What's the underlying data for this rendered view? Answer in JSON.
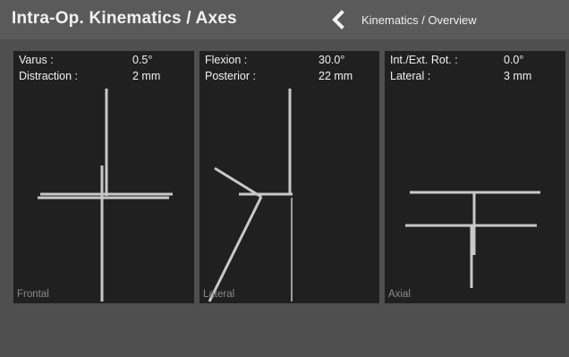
{
  "header": {
    "title": "Intra-Op. Kinematics / Axes",
    "back_label": "Kinematics / Overview",
    "back_icon": "chevron-left-icon"
  },
  "panels": {
    "frontal": {
      "rows": [
        {
          "label": "Varus :",
          "value": "0.5°"
        },
        {
          "label": "Distraction :",
          "value": "2 mm"
        }
      ],
      "view_label": "Frontal"
    },
    "lateral": {
      "rows": [
        {
          "label": "Flexion :",
          "value": "30.0°"
        },
        {
          "label": "Posterior :",
          "value": "22 mm"
        }
      ],
      "view_label": "Lateral"
    },
    "axial": {
      "rows": [
        {
          "label": "Int./Ext. Rot. :",
          "value": "0.0°"
        },
        {
          "label": "Lateral :",
          "value": "3 mm"
        }
      ],
      "view_label": "Axial"
    }
  },
  "colors": {
    "background": "#4f4f4f",
    "header": "#5a5a5a",
    "panel": "#202020",
    "axis": "#c8c8c8",
    "view_label": "#8a8a8a"
  }
}
